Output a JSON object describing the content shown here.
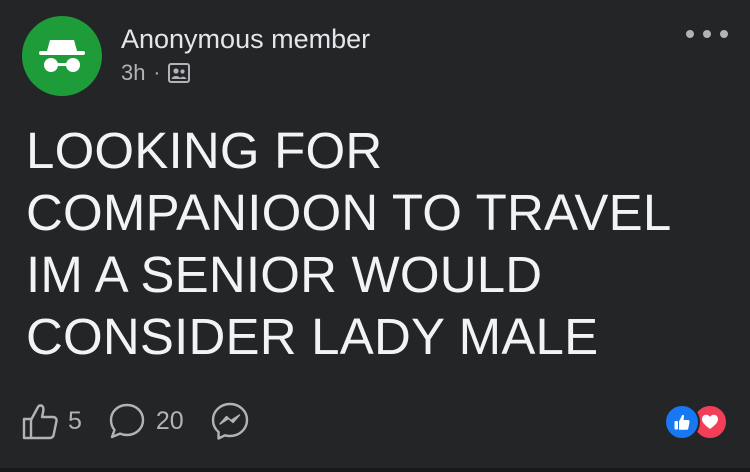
{
  "post": {
    "author": "Anonymous member",
    "time": "3h",
    "separator": "·",
    "audience_icon": "group-members-icon",
    "avatar_icon": "incognito-icon",
    "more_icon": "more-options-icon",
    "text_lines": [
      "LOOKING FOR",
      "COMPANIOON TO TRAVEL",
      "IM A SENIOR WOULD",
      "CONSIDER LADY MALE"
    ]
  },
  "actions": {
    "like_icon": "thumbs-up-icon",
    "like_count": "5",
    "comment_icon": "comment-bubble-icon",
    "comment_count": "20",
    "share_icon": "messenger-icon"
  },
  "reactions": [
    {
      "name": "like-reaction-icon",
      "color": "#1877f2"
    },
    {
      "name": "love-reaction-icon",
      "color": "#f33e58"
    }
  ],
  "colors": {
    "background": "#242526",
    "avatar": "#1e9c3a",
    "text": "#e4e6eb",
    "secondary_text": "#b0b3b8"
  }
}
